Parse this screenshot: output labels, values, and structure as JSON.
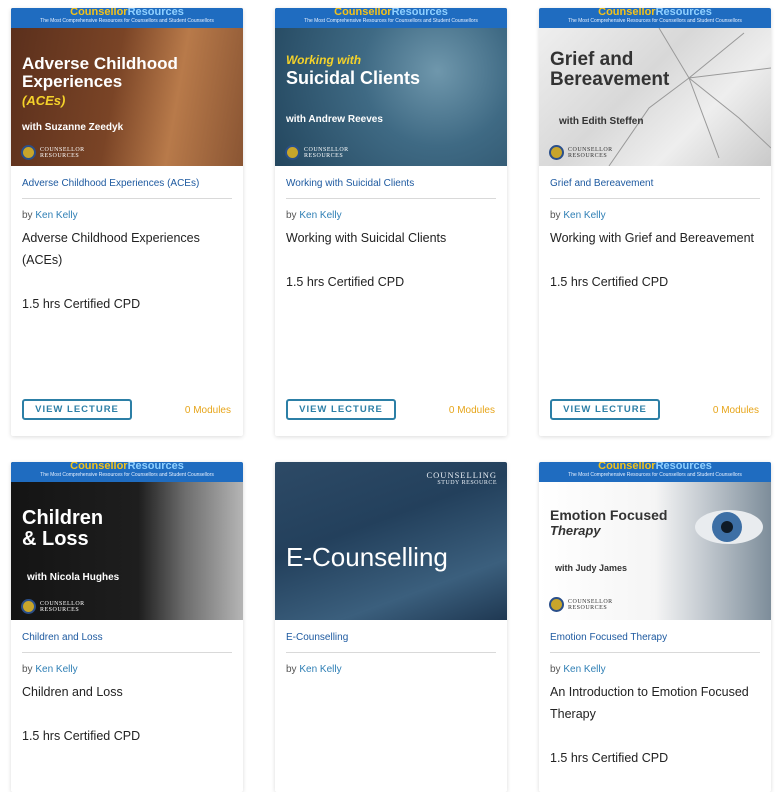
{
  "brand": {
    "name_a": "Counsellor",
    "name_b": "Resources",
    "tagline": "The Most Comprehensive Resources for Counsellors and Student Counsellors",
    "logo_text_1": "COUNSELLOR",
    "logo_text_2": "RESOURCES"
  },
  "buttons": {
    "view": "VIEW LECTURE"
  },
  "cards": [
    {
      "img_title": "Adverse Childhood Experiences",
      "img_title_2": "(ACEs)",
      "img_sub": "with Suzanne Zeedyk",
      "link": "Adverse Childhood Experiences (ACEs)",
      "by": "by",
      "author": "Ken Kelly",
      "title": "Adverse Childhood Experiences (ACEs)",
      "cpd": "1.5 hrs Certified CPD",
      "modules": "0 Modules"
    },
    {
      "img_title": "Working with",
      "img_title_2": "Suicidal Clients",
      "img_sub": "with Andrew Reeves",
      "link": "Working with Suicidal Clients",
      "by": "by",
      "author": "Ken Kelly",
      "title": "Working with Suicidal Clients",
      "cpd": "1.5 hrs Certified CPD",
      "modules": "0 Modules"
    },
    {
      "img_title": "Grief and",
      "img_title_2": "Bereavement",
      "img_sub": "with Edith Steffen",
      "link": "Grief and Bereavement",
      "by": "by",
      "author": "Ken Kelly",
      "title": "Working with Grief and Bereavement",
      "cpd": "1.5 hrs Certified CPD",
      "modules": "0 Modules"
    },
    {
      "img_title": "Children",
      "img_title_2": "& Loss",
      "img_sub": "with Nicola Hughes",
      "link": "Children and Loss",
      "by": "by",
      "author": "Ken Kelly",
      "title": "Children and Loss",
      "cpd": "1.5 hrs Certified CPD"
    },
    {
      "img_title": "E-Counselling",
      "img_tag_1": "COUNSELLING",
      "img_tag_2": "STUDY RESOURCE",
      "link": "E-Counselling",
      "by": "by",
      "author": "Ken Kelly"
    },
    {
      "img_title": "Emotion Focused",
      "img_title_2": "Therapy",
      "img_sub": "with Judy James",
      "link": "Emotion Focused Therapy",
      "by": "by",
      "author": "Ken Kelly",
      "title": "An Introduction to Emotion Focused Therapy",
      "cpd": "1.5 hrs Certified CPD"
    }
  ]
}
